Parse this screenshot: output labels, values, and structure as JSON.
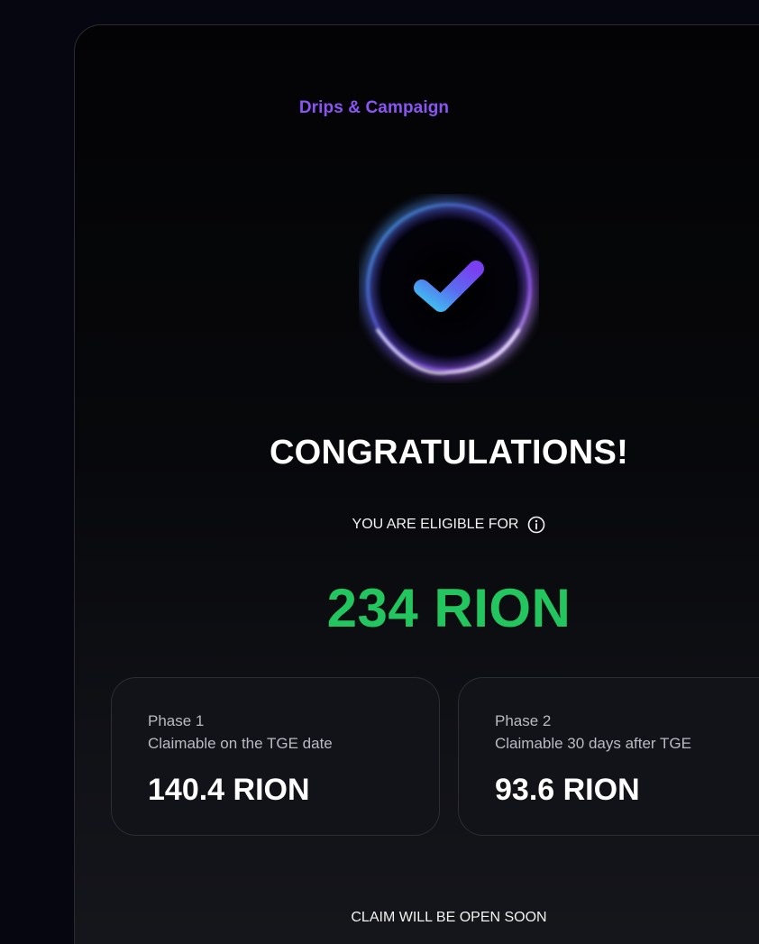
{
  "header": {
    "section_title": "Drips & Campaign"
  },
  "hero": {
    "icon": "check-circle-icon",
    "title": "CONGRATULATIONS!",
    "eligible_label": "YOU ARE ELIGIBLE FOR",
    "info_icon": "info-icon",
    "amount": "234 RION"
  },
  "phases": [
    {
      "label": "Phase 1",
      "description": "Claimable on the TGE date",
      "amount": "140.4 RION"
    },
    {
      "label": "Phase 2",
      "description": "Claimable 30 days after TGE",
      "amount": "93.6 RION"
    }
  ],
  "footer": {
    "claim_note": "CLAIM WILL BE OPEN SOON"
  },
  "colors": {
    "accent_purple": "#8b55f5",
    "amount_green": "#22c55e",
    "background": "#05060f"
  }
}
